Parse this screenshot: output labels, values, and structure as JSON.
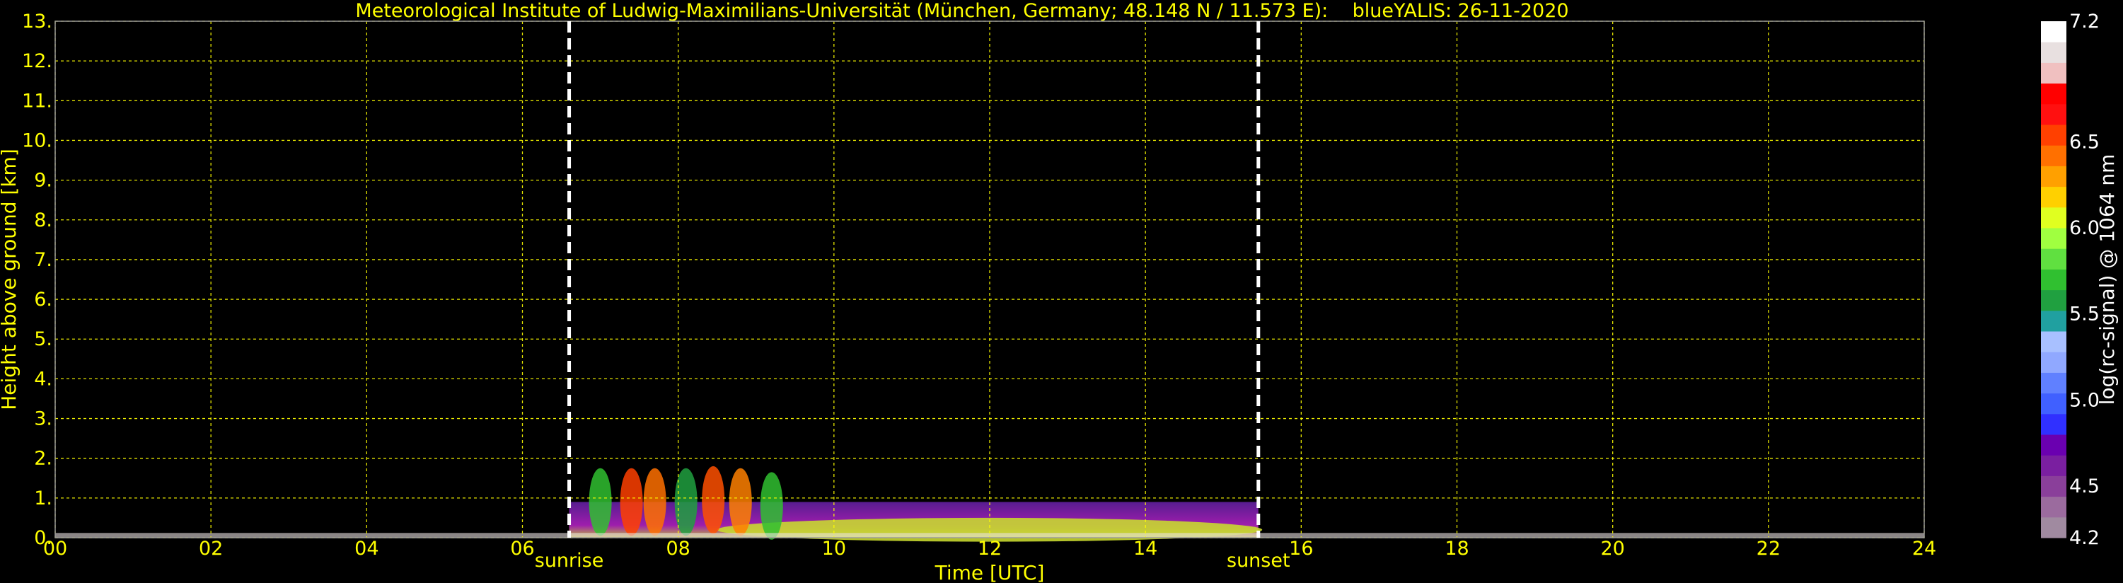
{
  "chart_data": {
    "type": "heatmap",
    "title": "Meteorological Institute of Ludwig-Maximilians-Universität (München, Germany; 48.148 N / 11.573 E):    blueYALIS: 26-11-2020",
    "xlabel": "Time [UTC]",
    "ylabel": "Height above ground [km]",
    "xlim": [
      0,
      24
    ],
    "ylim": [
      0,
      13
    ],
    "x_ticks": [
      "00",
      "02",
      "04",
      "06",
      "08",
      "10",
      "12",
      "14",
      "16",
      "18",
      "20",
      "22",
      "24"
    ],
    "y_ticks": [
      "0.",
      "1.",
      "2.",
      "3.",
      "4.",
      "5.",
      "6.",
      "7.",
      "8.",
      "9.",
      "10.",
      "11.",
      "12.",
      "13."
    ],
    "grid": true,
    "grid_color": "#ffff00",
    "events": [
      {
        "label": "sunrise",
        "time": 6.6
      },
      {
        "label": "sunset",
        "time": 15.45
      }
    ],
    "colorbar": {
      "label": "log(rc-signal) @ 1064 nm",
      "range": [
        4.2,
        7.2
      ],
      "tick_labels": [
        "4.2",
        "4.5",
        "5.0",
        "5.5",
        "6.0",
        "6.5",
        "7.2"
      ],
      "tick_values": [
        4.2,
        4.5,
        5.0,
        5.5,
        6.0,
        6.5,
        7.2
      ],
      "colors": [
        "#a08aa0",
        "#9b6b9e",
        "#8a3f9a",
        "#7a1fa0",
        "#6a00b0",
        "#3030ff",
        "#4060ff",
        "#6080ff",
        "#90a8ff",
        "#a8c0ff",
        "#20a0a0",
        "#20a040",
        "#30c030",
        "#60e040",
        "#a0ff40",
        "#e0ff20",
        "#ffd000",
        "#ffa000",
        "#ff7000",
        "#ff4000",
        "#ff1010",
        "#ff0000",
        "#f0c0c0",
        "#e8e0e0",
        "#ffffff"
      ]
    }
  }
}
